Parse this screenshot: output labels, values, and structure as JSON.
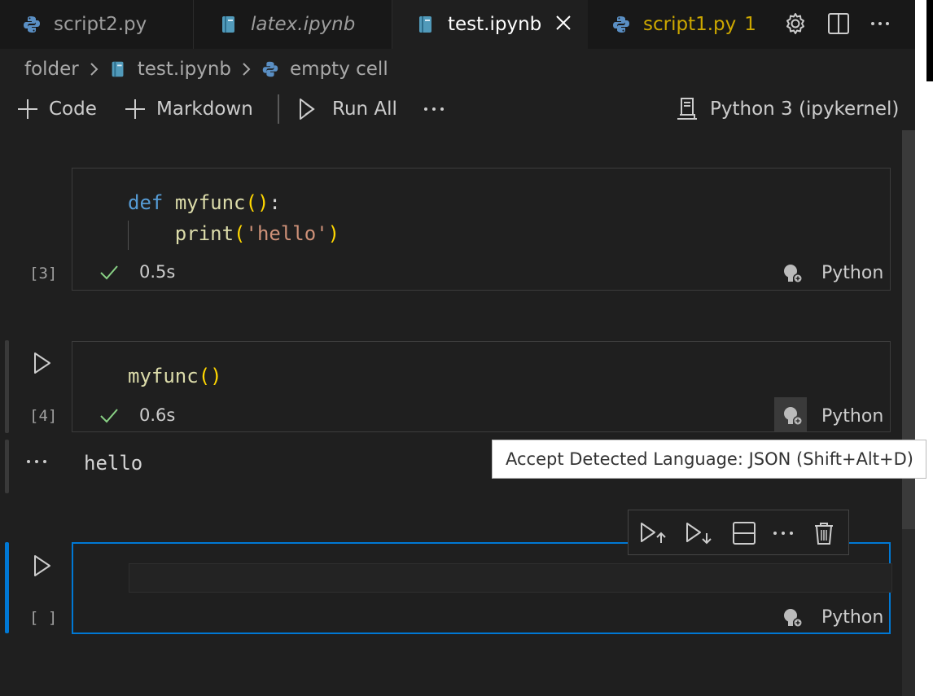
{
  "tabs": [
    {
      "label": "script2.py",
      "icon": "python-icon"
    },
    {
      "label": "latex.ipynb",
      "icon": "notebook-icon"
    },
    {
      "label": "test.ipynb",
      "icon": "notebook-icon",
      "active": true
    },
    {
      "label": "script1.py",
      "icon": "python-icon",
      "badge": "1"
    }
  ],
  "titlebar_actions": [
    "gear-icon",
    "split-editor-icon",
    "more-actions-icon"
  ],
  "breadcrumb": {
    "folder": "folder",
    "file": "test.ipynb",
    "symbol": "empty cell"
  },
  "toolbar": {
    "code": "Code",
    "markdown": "Markdown",
    "run_all": "Run All",
    "kernel": "Python 3 (ipykernel)"
  },
  "cells": [
    {
      "exec": "[3]",
      "code": [
        "def myfunc():",
        "    print('hello')"
      ],
      "status": "0.5s",
      "language": "Python"
    },
    {
      "exec": "[4]",
      "code": [
        "myfunc()"
      ],
      "status": "0.6s",
      "language": "Python",
      "output": "hello"
    },
    {
      "exec": "[ ]",
      "code": [
        ""
      ],
      "language": "Python"
    }
  ],
  "tooltip": "Accept Detected Language: JSON (Shift+Alt+D)",
  "cell_toolbar": [
    "run-above-icon",
    "run-below-icon",
    "split-cell-icon",
    "more-icon",
    "delete-icon"
  ],
  "colors": {
    "accent": "#0078d4",
    "success": "#89d185",
    "warning": "#cca700"
  }
}
